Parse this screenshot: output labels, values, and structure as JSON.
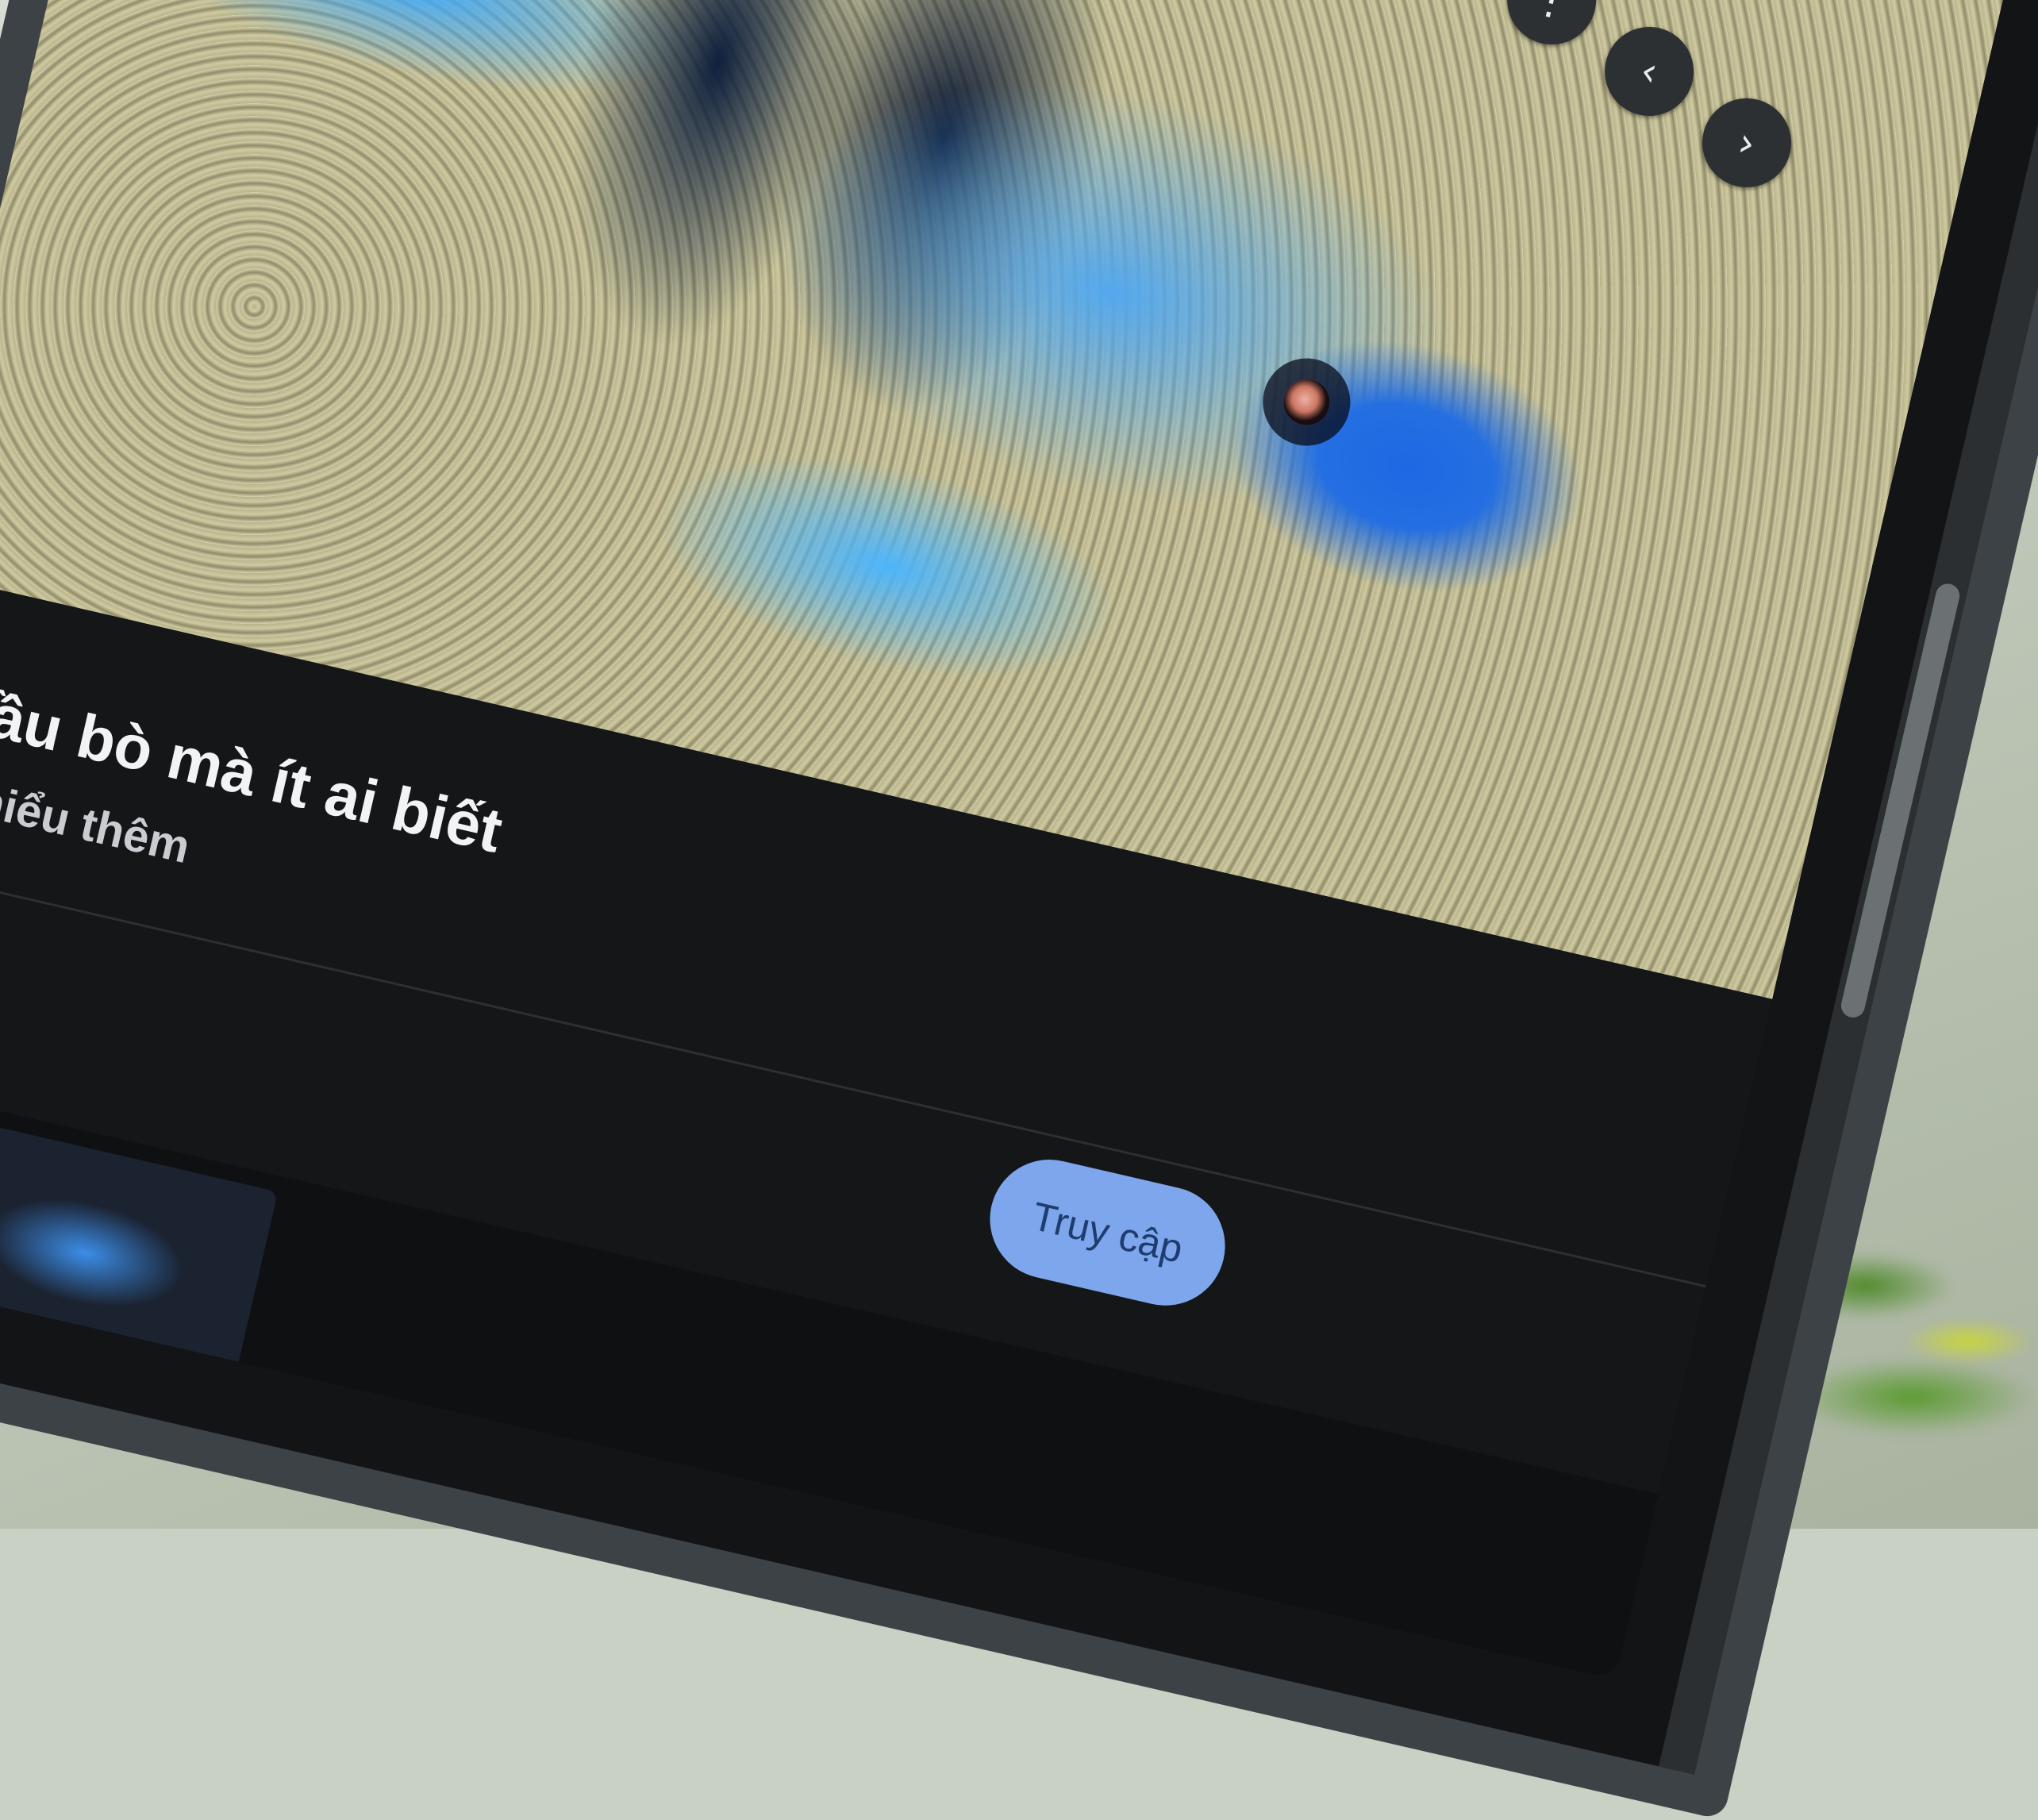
{
  "caption": {
    "title": "á đầu bò mà ít ai biết",
    "subtitle": "Tìm hiểu thêm",
    "visit_label": "Truy cập"
  },
  "controls": {
    "lens_icon": "lens-scan-icon",
    "more_icon": "more-vert-icon",
    "prev_icon": "chevron-left-icon",
    "next_icon": "chevron-right-icon"
  },
  "colors": {
    "visit_button_bg": "#7ea6ec",
    "screen_bg": "#121416",
    "control_bg": "#2d3033"
  }
}
